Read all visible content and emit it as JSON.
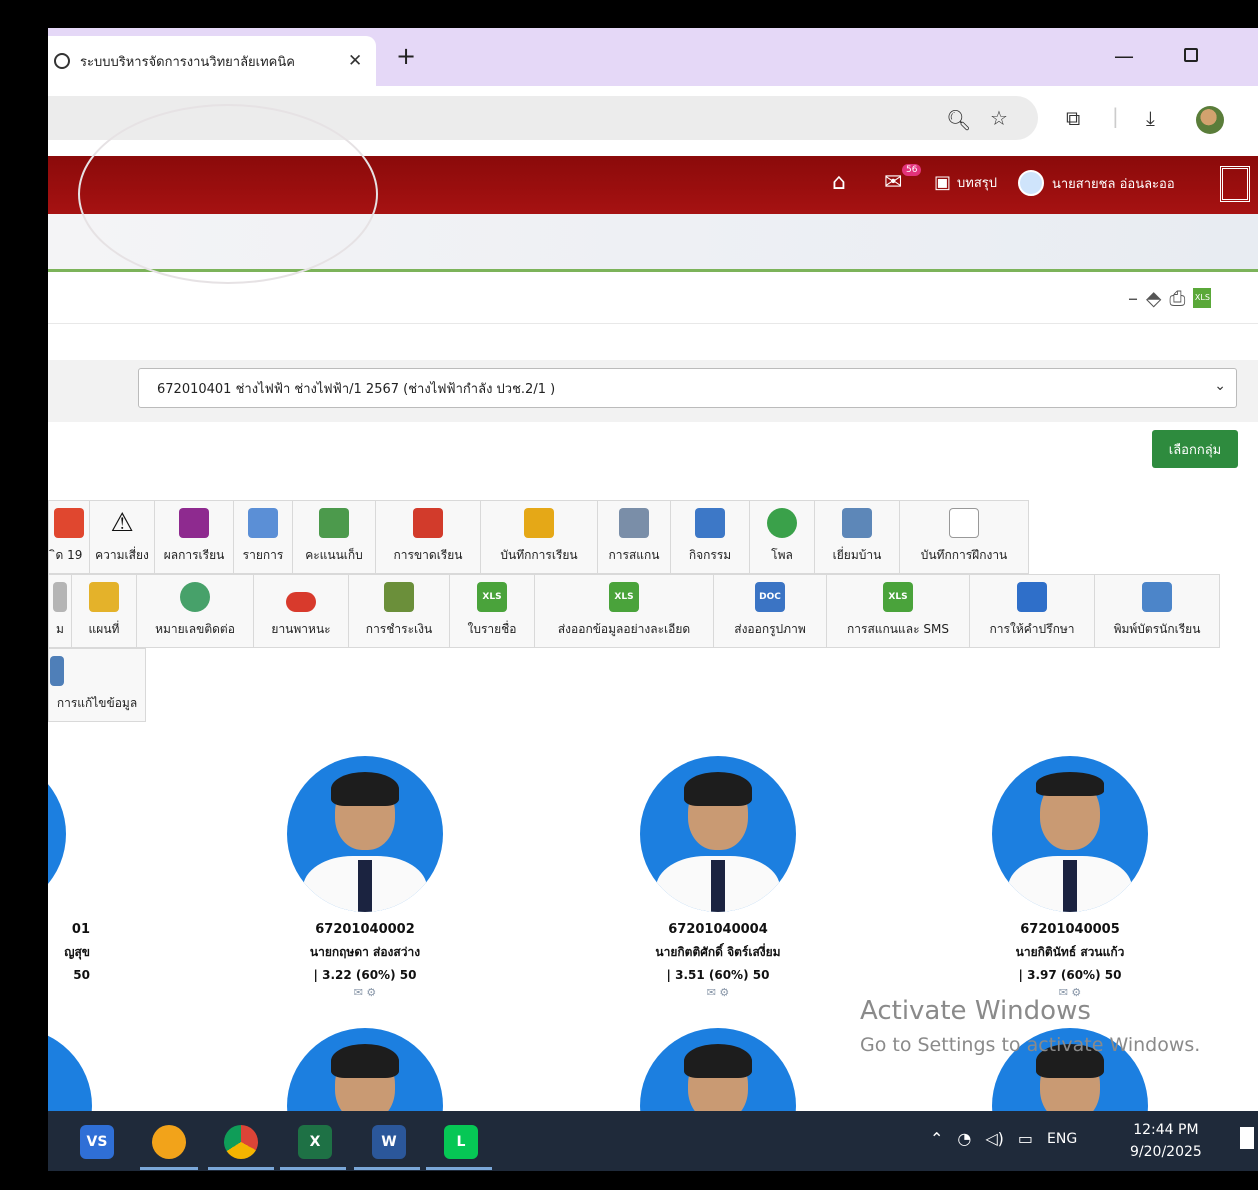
{
  "browser": {
    "tab_title": "ระบบบริหารจัดการงานวิทยาลัยเทคนิค",
    "tab_close": "✕",
    "new_tab": "+",
    "minimize": "—"
  },
  "header": {
    "notification_count": "56",
    "summary_label": "บทสรุป",
    "user_name": "นายสายชล อ่อนละออ"
  },
  "group_select": {
    "value": "672010401 ช่างไฟฟ้า ช่างไฟฟ้า/1 2567 (ช่างไฟฟ้ากำลัง ปวช.2/1 )"
  },
  "choose_group_button": "เลือกกลุ่ม",
  "menu": {
    "row1": [
      {
        "label": "ิด 19",
        "icon": "virus-icon",
        "color": "#e0472f"
      },
      {
        "label": "ความเสี่ยง",
        "icon": "warning-icon",
        "color": "#f2c200"
      },
      {
        "label": "ผลการเรียน",
        "icon": "bar-chart-icon",
        "color": "#8e2a8f"
      },
      {
        "label": "รายการ",
        "icon": "list-window-icon",
        "color": "#5b8fd6"
      },
      {
        "label": "คะแนนเก็บ",
        "icon": "grid-chart-icon",
        "color": "#4c9a4c"
      },
      {
        "label": "การขาดเรียน",
        "icon": "absence-clock-icon",
        "color": "#d23b2b"
      },
      {
        "label": "บันทึกการเรียน",
        "icon": "pencil-note-icon",
        "color": "#e5a817"
      },
      {
        "label": "การสแกน",
        "icon": "calendar-icon",
        "color": "#7a8ea8"
      },
      {
        "label": "กิจกรรม",
        "icon": "activity-board-icon",
        "color": "#3d78c7"
      },
      {
        "label": "โพล",
        "icon": "pie-chart-icon",
        "color": "#3aa14a"
      },
      {
        "label": "เยี่ยมบ้าน",
        "icon": "home-visit-icon",
        "color": "#5d87b8"
      },
      {
        "label": "บันทึกการฝึกงาน",
        "icon": "document-icon",
        "color": "#9a9a9a"
      }
    ],
    "row2": [
      {
        "label": "ม",
        "icon": "partial-icon",
        "color": "#b5b5b5"
      },
      {
        "label": "แผนที่",
        "icon": "map-icon",
        "color": "#e4b22a"
      },
      {
        "label": "หมายเลขติดต่อ",
        "icon": "phone-icon",
        "color": "#47a16a"
      },
      {
        "label": "ยานพาหนะ",
        "icon": "car-icon",
        "color": "#d83a2c"
      },
      {
        "label": "การชำระเงิน",
        "icon": "money-icon",
        "color": "#6b8f3a"
      },
      {
        "label": "ใบรายชื่อ",
        "icon": "xls-icon",
        "color": "#4aa33b"
      },
      {
        "label": "ส่งออกข้อมูลอย่างละเอียด",
        "icon": "xls-icon",
        "color": "#4aa33b"
      },
      {
        "label": "ส่งออกรูปภาพ",
        "icon": "doc-icon",
        "color": "#3b74c4"
      },
      {
        "label": "การสแกนและ SMS",
        "icon": "xls-icon",
        "color": "#4aa33b"
      },
      {
        "label": "การให้คำปรึกษา",
        "icon": "info-folder-icon",
        "color": "#2f6fc9"
      },
      {
        "label": "พิมพ์บัตรนักเรียน",
        "icon": "id-card-icon",
        "color": "#4c85c9"
      }
    ],
    "row3": [
      {
        "label": "การแก้ไขข้อมูล",
        "icon": "edit-record-icon",
        "color": "#4f7fb8"
      }
    ],
    "xls_text": "XLS",
    "doc_text": "DOC"
  },
  "students": [
    {
      "id": "01",
      "name": "ญสุข",
      "gpa": "50"
    },
    {
      "id": "67201040002",
      "name": "นายกฤษดา ส่องสว่าง",
      "gpa": "| 3.22 (60%) 50"
    },
    {
      "id": "67201040004",
      "name": "นายกิตติศักดิ์ จิตร์เสงี่ยม",
      "gpa": "| 3.51 (60%) 50"
    },
    {
      "id": "67201040005",
      "name": "นายกิตินัทธ์ สวนแก้ว",
      "gpa": "| 3.97 (60%) 50"
    }
  ],
  "watermark": {
    "line1": "Activate Windows",
    "line2": "Go to Settings to activate Windows."
  },
  "taskbar": {
    "apps": [
      "VS",
      "browser",
      "chrome",
      "excel",
      "word",
      "line"
    ],
    "lang": "ENG",
    "time": "12:44 PM",
    "date": "9/20/2025"
  }
}
